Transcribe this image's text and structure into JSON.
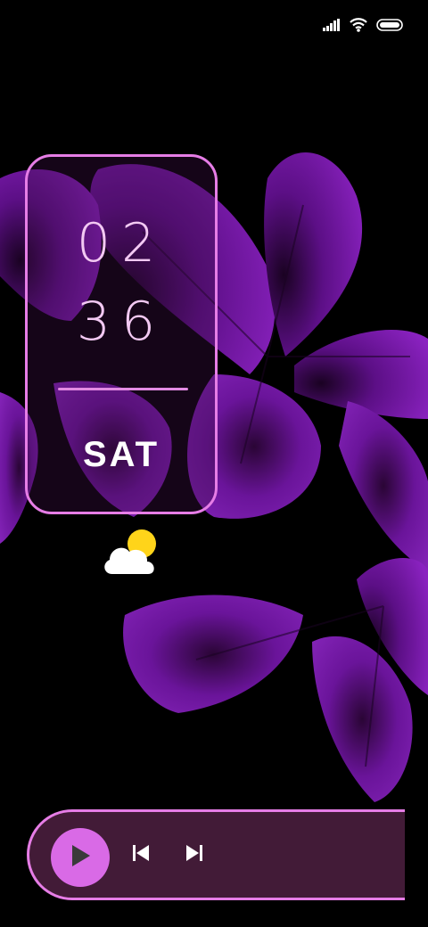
{
  "clock": {
    "hours": "02",
    "minutes": "36",
    "day": "SAT"
  },
  "status_bar": {
    "signal": "signal-icon",
    "wifi": "wifi-icon",
    "battery": "battery-icon"
  },
  "weather": {
    "icon": "partly-cloudy-icon"
  },
  "music_player": {
    "play": "play-icon",
    "previous": "skip-previous-icon",
    "next": "skip-next-icon"
  },
  "colors": {
    "accent": "#e67de6",
    "play_button": "#d96ae6",
    "clock_text": "#f3c9f3",
    "flower": "#7a1aa8"
  }
}
